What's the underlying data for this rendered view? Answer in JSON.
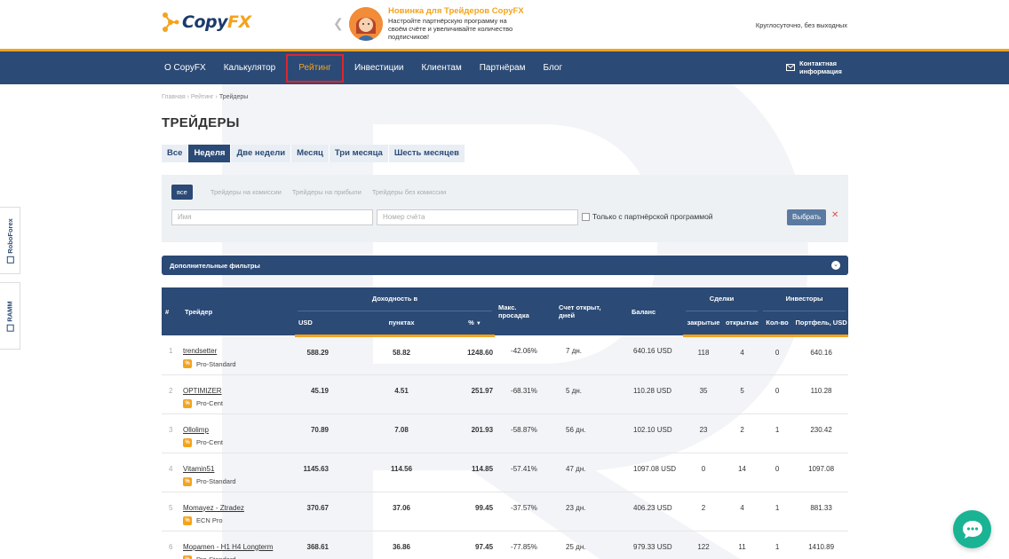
{
  "header": {
    "logo": {
      "copy": "Copy",
      "fx": "FX"
    },
    "promo": {
      "title": "Новинка для Трейдеров CopyFX",
      "desc": "Настройте партнёрскую программу на своём счёте и увеличивайте количество подписчиков!"
    },
    "hours": "Круглосуточно, без выходных"
  },
  "nav": {
    "items": [
      "О CopyFX",
      "Калькулятор",
      "Рейтинг",
      "Инвестиции",
      "Клиентам",
      "Партнёрам",
      "Блог"
    ],
    "active_index": 2,
    "contact_label": "Контактная информация"
  },
  "breadcrumb": [
    "Главная",
    "Рейтинг",
    "Трейдеры"
  ],
  "page_title": "ТРЕЙДЕРЫ",
  "periods": {
    "items": [
      "Все",
      "Неделя",
      "Две недели",
      "Месяц",
      "Три месяца",
      "Шесть месяцев"
    ],
    "active_index": 1
  },
  "filters": {
    "tabs": [
      "все",
      "Трейдеры на комиссии",
      "Трейдеры на прибыли",
      "Трейдеры без комиссии"
    ],
    "name_placeholder": "Имя",
    "account_placeholder": "Номер счёта",
    "partner_checkbox": "Только с партнёрской программой",
    "submit": "Выбрать",
    "clear": "✕",
    "extra_label": "Дополнительные фильтры"
  },
  "table": {
    "headers": {
      "num": "#",
      "trader": "Трейдер",
      "yield": "Доходность в",
      "usd": "USD",
      "points": "пунктах",
      "pct": "%",
      "sort_arrow": "▼",
      "drawdown": "Макс. просадка",
      "open": "Счет открыт, дней",
      "balance": "Баланс",
      "deals": "Сделки",
      "closed": "закрытые",
      "opened": "открытые",
      "investors": "Инвесторы",
      "count": "Кол-во",
      "portfolio": "Портфель, USD"
    },
    "rows": [
      {
        "n": "1",
        "name": "trendsetter",
        "acc": "Pro-Standard",
        "usd": "588.29",
        "pts": "58.82",
        "pct": "1248.60",
        "dd": "-42.06%",
        "days": "7 дн.",
        "bal": "640.16 USD",
        "closed": "118",
        "open": "4",
        "inv": "0",
        "port": "640.16"
      },
      {
        "n": "2",
        "name": "OPTIMIZER",
        "acc": "Pro-Cent",
        "usd": "45.19",
        "pts": "4.51",
        "pct": "251.97",
        "dd": "-68.31%",
        "days": "5 дн.",
        "bal": "110.28 USD",
        "closed": "35",
        "open": "5",
        "inv": "0",
        "port": "110.28"
      },
      {
        "n": "3",
        "name": "Ollolimp",
        "acc": "Pro-Cent",
        "usd": "70.89",
        "pts": "7.08",
        "pct": "201.93",
        "dd": "-58.87%",
        "days": "56 дн.",
        "bal": "102.10 USD",
        "closed": "23",
        "open": "2",
        "inv": "1",
        "port": "230.42"
      },
      {
        "n": "4",
        "name": "Vitamin51",
        "acc": "Pro-Standard",
        "usd": "1145.63",
        "pts": "114.56",
        "pct": "114.85",
        "dd": "-57.41%",
        "days": "47 дн.",
        "bal": "1097.08 USD",
        "closed": "0",
        "open": "14",
        "inv": "0",
        "port": "1097.08"
      },
      {
        "n": "5",
        "name": "Momayez - Ztradez",
        "acc": "ECN Pro",
        "usd": "370.67",
        "pts": "37.06",
        "pct": "99.45",
        "dd": "-37.57%",
        "days": "23 дн.",
        "bal": "406.23 USD",
        "closed": "2",
        "open": "4",
        "inv": "1",
        "port": "881.33"
      },
      {
        "n": "6",
        "name": "Mopamen - H1 H4 Longterm",
        "acc": "Pro-Standard",
        "usd": "368.61",
        "pts": "36.86",
        "pct": "97.45",
        "dd": "-77.85%",
        "days": "25 дн.",
        "bal": "979.33 USD",
        "closed": "122",
        "open": "11",
        "inv": "1",
        "port": "1410.89"
      }
    ]
  },
  "side_tabs": [
    "RoboForex",
    "RAMM"
  ],
  "colors": {
    "nav": "#2b4a75",
    "accent": "#f4a31d",
    "highlight": "#e0242b",
    "chat": "#1ab394"
  },
  "icons": {
    "promo_arrow": "chevron-left-icon",
    "contact": "envelope-icon",
    "chat": "chat-bubble-icon",
    "account_type": "percent-icon"
  }
}
